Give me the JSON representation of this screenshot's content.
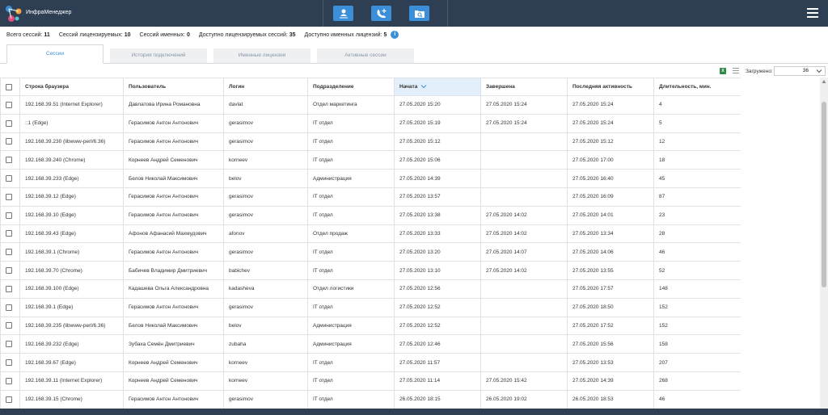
{
  "app": {
    "title": "ИнфраМенеджер"
  },
  "stats": [
    {
      "label": "Всего сессий:",
      "value": "11"
    },
    {
      "label": "Сессий лицензируемых:",
      "value": "10"
    },
    {
      "label": "Сессий именных:",
      "value": "0"
    },
    {
      "label": "Доступно лицензируемых сессий:",
      "value": "35"
    },
    {
      "label": "Доступно именных лицензий:",
      "value": "5"
    }
  ],
  "info_glyph": "i",
  "tabs": [
    "Сессии",
    "История подключений",
    "Именные лицензии",
    "Активные сессии"
  ],
  "toolbar": {
    "export_glyph": "X",
    "loaded_label": "Загружено:",
    "loaded_value": "36"
  },
  "columns": [
    "Строка браузера",
    "Пользователь",
    "Логин",
    "Подразделение",
    "Начата",
    "Завершена",
    "Последняя активность",
    "Длительность, мин."
  ],
  "rows": [
    [
      "192.168.39.51 (Internet Explorer)",
      "Давлатова Ирина Романовна",
      "davlat",
      "Отдел маркетинга",
      "27.05.2020 15:20",
      "27.05.2020 15:24",
      "27.05.2020 15:24",
      "4"
    ],
    [
      "::1 (Edge)",
      "Герасимов Антон Антонович",
      "gerasimov",
      "IT отдел",
      "27.05.2020 15:19",
      "27.05.2020 15:24",
      "27.05.2020 15:24",
      "5"
    ],
    [
      "192.168.39.230 (libwww-perl/6.36)",
      "Герасимов Антон Антонович",
      "gerasimov",
      "IT отдел",
      "27.05.2020 15:12",
      "",
      "27.05.2020 15:12",
      "12"
    ],
    [
      "192.168.39.240 (Chrome)",
      "Корнеев Андрей Семенович",
      "korneev",
      "IT отдел",
      "27.05.2020 15:06",
      "",
      "27.05.2020 17:00",
      "18"
    ],
    [
      "192.168.39.233 (Edge)",
      "Белов Николай Максимович",
      "belov",
      "Администрация",
      "27.05.2020 14:39",
      "",
      "27.05.2020 16:40",
      "45"
    ],
    [
      "192.168.39.12 (Edge)",
      "Герасимов Антон Антонович",
      "gerasimov",
      "IT отдел",
      "27.05.2020 13:57",
      "",
      "27.05.2020 16:09",
      "87"
    ],
    [
      "192.168.39.10 (Edge)",
      "Герасимов Антон Антонович",
      "gerasimov",
      "IT отдел",
      "27.05.2020 13:38",
      "27.05.2020 14:02",
      "27.05.2020 14:01",
      "23"
    ],
    [
      "192.168.39.43 (Edge)",
      "Афонов Афанасий Махмудович",
      "afonov",
      "Отдел продаж",
      "27.05.2020 13:33",
      "27.05.2020 14:02",
      "27.05.2020 13:34",
      "28"
    ],
    [
      "192.168.39.1 (Chrome)",
      "Герасимов Антон Антонович",
      "gerasimov",
      "IT отдел",
      "27.05.2020 13:20",
      "27.05.2020 14:07",
      "27.05.2020 14:06",
      "46"
    ],
    [
      "192.168.39.70 (Chrome)",
      "Бабичев Владимир Дмитриевич",
      "babichev",
      "IT отдел",
      "27.05.2020 13:10",
      "27.05.2020 14:02",
      "27.05.2020 13:55",
      "52"
    ],
    [
      "192.168.39.100 (Edge)",
      "Кадашева Ольга Александровна",
      "kadasheva",
      "Отдел логистики",
      "27.05.2020 12:56",
      "",
      "27.05.2020 17:57",
      "148"
    ],
    [
      "192.168.39.1 (Edge)",
      "Герасимов Антон Антонович",
      "gerasimov",
      "IT отдел",
      "27.05.2020 12:52",
      "",
      "27.05.2020 18:50",
      "152"
    ],
    [
      "192.168.39.235 (libwww-perl/6.36)",
      "Белов Николай Максимович",
      "belov",
      "Администрация",
      "27.05.2020 12:52",
      "",
      "27.05.2020 17:52",
      "152"
    ],
    [
      "192.168.39.232 (Edge)",
      "Зубаха Семён Дмитриевич",
      "zubaha",
      "Администрация",
      "27.05.2020 12:46",
      "",
      "27.05.2020 15:56",
      "158"
    ],
    [
      "192.168.39.67 (Edge)",
      "Корнеев Андрей Семенович",
      "korneev",
      "IT отдел",
      "27.05.2020 11:57",
      "",
      "27.05.2020 13:53",
      "207"
    ],
    [
      "192.168.39.11 (Internet Explorer)",
      "Корнеев Андрей Семенович",
      "korneev",
      "IT отдел",
      "27.05.2020 11:14",
      "27.05.2020 15:42",
      "27.05.2020 14:39",
      "268"
    ],
    [
      "192.168.39.15 (Chrome)",
      "Герасимов Антон Антонович",
      "gerasimov",
      "IT отдел",
      "26.05.2020 18:15",
      "26.05.2020 19:02",
      "26.05.2020 18:53",
      "46"
    ]
  ],
  "icons": {
    "logo": "network-logo-icon",
    "users": "user-network-icon",
    "calls": "phone-add-icon",
    "folder": "folder-search-icon",
    "menu": "hamburger-menu-icon"
  },
  "colors": {
    "header_bg": "#2e3e53",
    "accent": "#3a8fd8",
    "sorted_col_bg": "#e3f0fb",
    "excel_green": "#2f8a4c"
  }
}
